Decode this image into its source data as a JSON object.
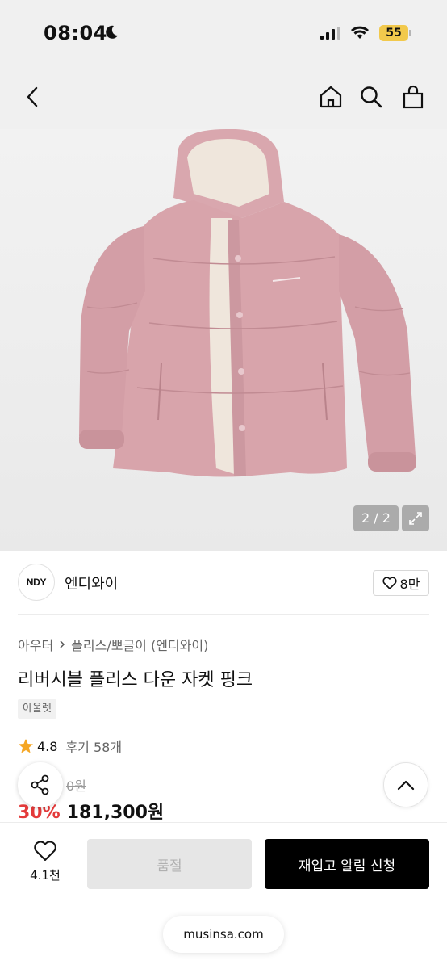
{
  "status_bar": {
    "time": "08:04",
    "battery": "55"
  },
  "header": {
    "icons": [
      "back-icon",
      "home-icon",
      "search-icon",
      "cart-icon"
    ]
  },
  "gallery": {
    "counter": "2 / 2"
  },
  "brand": {
    "logo_text": "NDY",
    "name": "엔디와이",
    "like_count": "8만"
  },
  "breadcrumb": {
    "items": [
      "아우터",
      "플리스/뽀글이 (엔디와이)"
    ]
  },
  "product": {
    "title": "리버시블 플리스 다운 자켓 핑크",
    "tag": "아울렛",
    "rating": "4.8",
    "review_label": "후기 58개",
    "original_price_partial": "0원",
    "discount": "30%",
    "sale_price": "181,300원"
  },
  "bottom_bar": {
    "wish_count": "4.1천",
    "soldout_label": "품절",
    "restock_label": "재입고 알림 신청"
  },
  "browser": {
    "url": "musinsa.com"
  },
  "colors": {
    "accent_red": "#e43a3a",
    "star": "#f5a623",
    "jacket": "#d9a5ad"
  }
}
